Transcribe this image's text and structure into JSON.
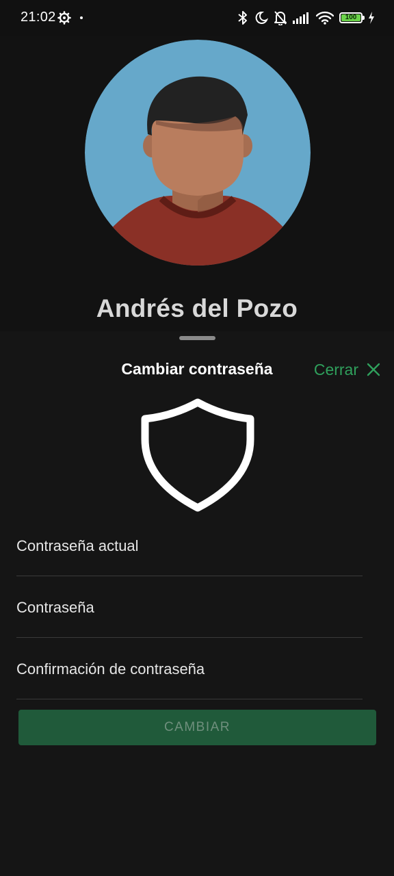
{
  "status_bar": {
    "time": "21:02",
    "battery_level": "100",
    "icons": [
      "settings-gear-icon",
      "notification-dot-icon",
      "bluetooth-icon",
      "moon-icon",
      "bell-off-icon",
      "signal-icon",
      "wifi-icon",
      "battery-icon",
      "charging-icon"
    ]
  },
  "profile": {
    "name": "Andrés del Pozo",
    "avatar_icon": "avatar-person-icon",
    "colors": {
      "avatar_bg": "#66a8ca",
      "skin": "#b97d5e",
      "hair": "#222222",
      "shirt": "#8a3026"
    }
  },
  "sheet": {
    "title": "Cambiar contraseña",
    "close_label": "Cerrar",
    "close_icon": "close-x-icon",
    "header_icon": "shield-icon",
    "fields": [
      {
        "placeholder": "Contraseña actual"
      },
      {
        "placeholder": "Contraseña"
      },
      {
        "placeholder": "Confirmación de contraseña"
      }
    ],
    "submit_label": "CAMBIAR"
  },
  "colors": {
    "accent": "#2fa05c",
    "button_bg": "#205a3a",
    "background": "#121212"
  }
}
